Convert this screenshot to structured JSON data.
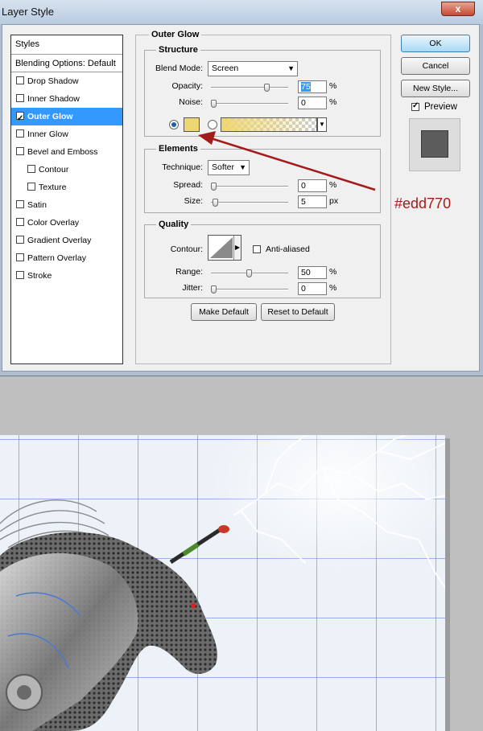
{
  "window": {
    "title": "Layer Style",
    "close_glyph": "x"
  },
  "styles": {
    "header": "Styles",
    "blending": "Blending Options: Default",
    "items": [
      {
        "label": "Drop Shadow",
        "checked": false,
        "selected": false,
        "sub": false
      },
      {
        "label": "Inner Shadow",
        "checked": false,
        "selected": false,
        "sub": false
      },
      {
        "label": "Outer Glow",
        "checked": true,
        "selected": true,
        "sub": false
      },
      {
        "label": "Inner Glow",
        "checked": false,
        "selected": false,
        "sub": false
      },
      {
        "label": "Bevel and Emboss",
        "checked": false,
        "selected": false,
        "sub": false
      },
      {
        "label": "Contour",
        "checked": false,
        "selected": false,
        "sub": true
      },
      {
        "label": "Texture",
        "checked": false,
        "selected": false,
        "sub": true
      },
      {
        "label": "Satin",
        "checked": false,
        "selected": false,
        "sub": false
      },
      {
        "label": "Color Overlay",
        "checked": false,
        "selected": false,
        "sub": false
      },
      {
        "label": "Gradient Overlay",
        "checked": false,
        "selected": false,
        "sub": false
      },
      {
        "label": "Pattern Overlay",
        "checked": false,
        "selected": false,
        "sub": false
      },
      {
        "label": "Stroke",
        "checked": false,
        "selected": false,
        "sub": false
      }
    ]
  },
  "panel": {
    "title": "Outer Glow",
    "structure": {
      "title": "Structure",
      "blend_mode_label": "Blend Mode:",
      "blend_mode_value": "Screen",
      "opacity_label": "Opacity:",
      "opacity_value": "75",
      "opacity_level": 0.75,
      "noise_label": "Noise:",
      "noise_value": "0",
      "noise_level": 0,
      "percent": "%",
      "glow_color": "#edd770"
    },
    "elements": {
      "title": "Elements",
      "technique_label": "Technique:",
      "technique_value": "Softer",
      "spread_label": "Spread:",
      "spread_value": "0",
      "spread_level": 0,
      "size_label": "Size:",
      "size_value": "5",
      "size_level": 0.02,
      "percent": "%",
      "px": "px"
    },
    "quality": {
      "title": "Quality",
      "contour_label": "Contour:",
      "anti_aliased_label": "Anti-aliased",
      "anti_aliased": false,
      "range_label": "Range:",
      "range_value": "50",
      "range_level": 0.5,
      "jitter_label": "Jitter:",
      "jitter_value": "0",
      "jitter_level": 0,
      "percent": "%"
    },
    "make_default": "Make Default",
    "reset_default": "Reset to Default"
  },
  "actions": {
    "ok": "OK",
    "cancel": "Cancel",
    "new_style": "New Style...",
    "preview_label": "Preview",
    "preview_checked": true
  },
  "annotation": {
    "hex": "#edd770"
  }
}
